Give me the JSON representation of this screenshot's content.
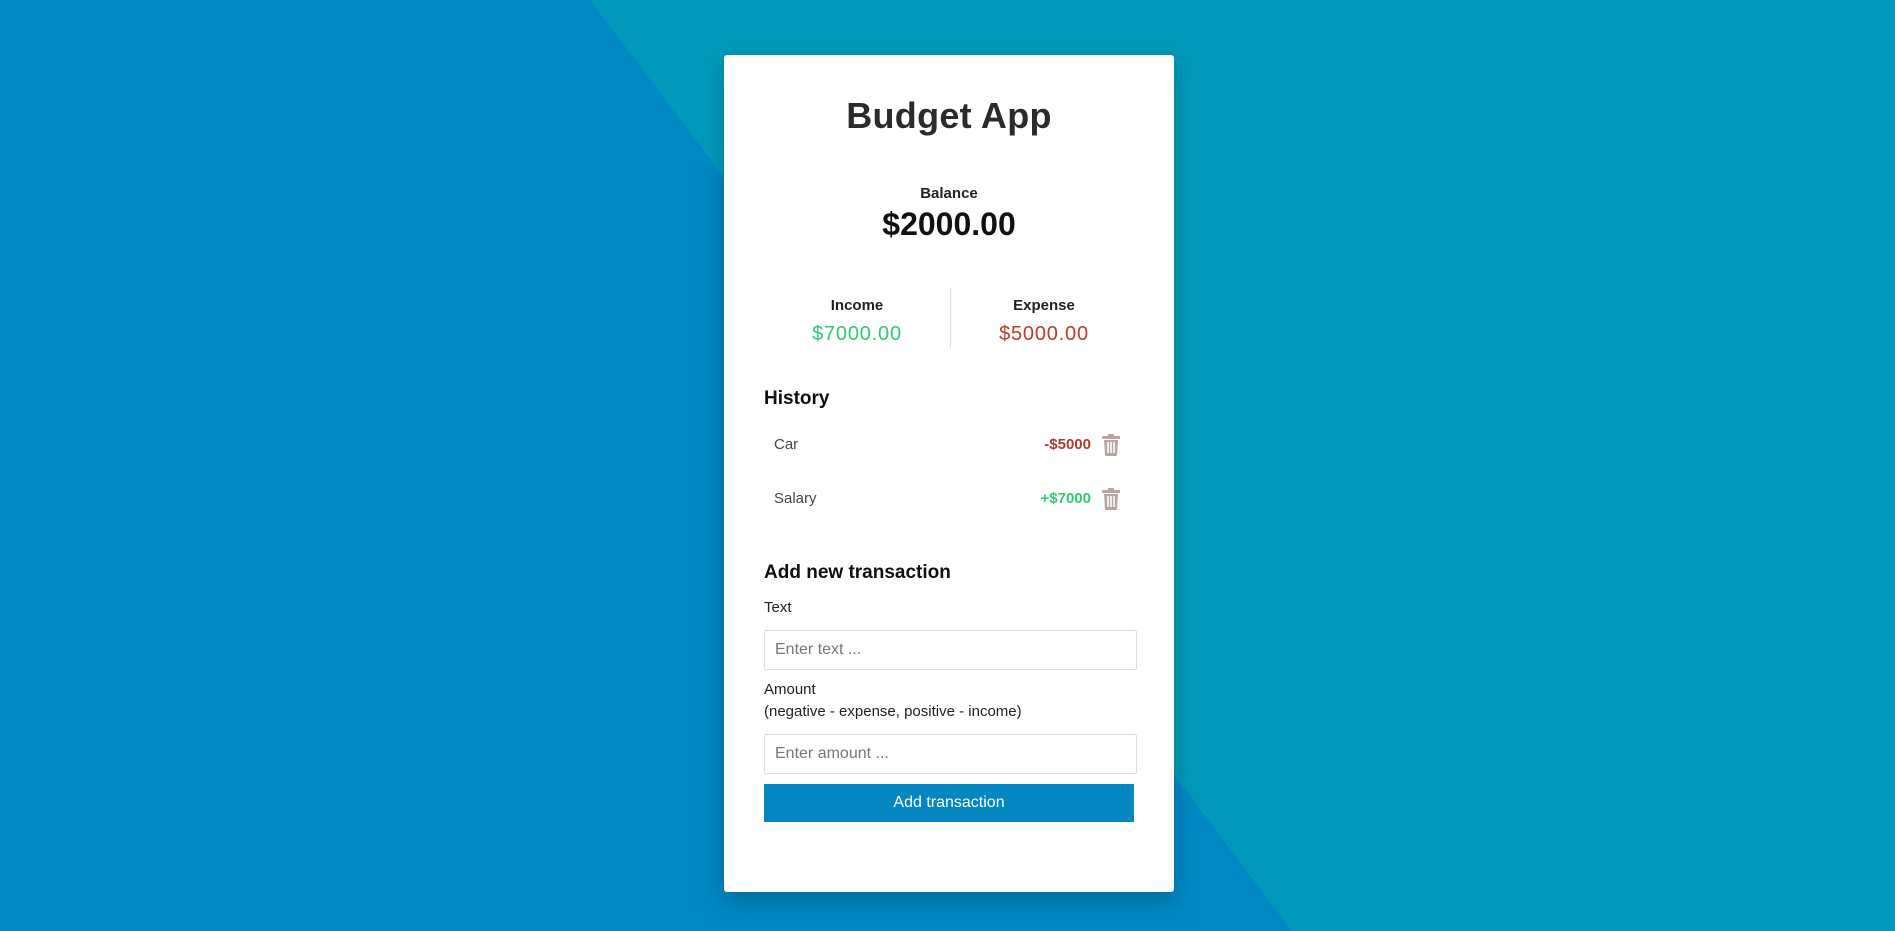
{
  "app": {
    "title": "Budget App"
  },
  "balance": {
    "label": "Balance",
    "value": "$2000.00"
  },
  "income": {
    "label": "Income",
    "value": "$7000.00"
  },
  "expense": {
    "label": "Expense",
    "value": "$5000.00"
  },
  "history": {
    "title": "History",
    "items": [
      {
        "text": "Car",
        "amount": "-$5000",
        "type": "minus",
        "icon": "trash-icon"
      },
      {
        "text": "Salary",
        "amount": "+$7000",
        "type": "plus",
        "icon": "trash-icon"
      }
    ]
  },
  "form": {
    "title": "Add new transaction",
    "text_label": "Text",
    "text_placeholder": "Enter text ...",
    "text_value": "",
    "amount_label": "Amount",
    "amount_hint": "(negative - expense, positive - income)",
    "amount_placeholder": "Enter amount ...",
    "amount_value": "",
    "submit_label": "Add transaction"
  },
  "colors": {
    "background": "#0199bb",
    "background_dark": "#0088c2",
    "card": "#ffffff",
    "income": "#2ecc71",
    "expense": "#c0392b",
    "button": "#0487c1",
    "trash": "#b9a4a4"
  }
}
